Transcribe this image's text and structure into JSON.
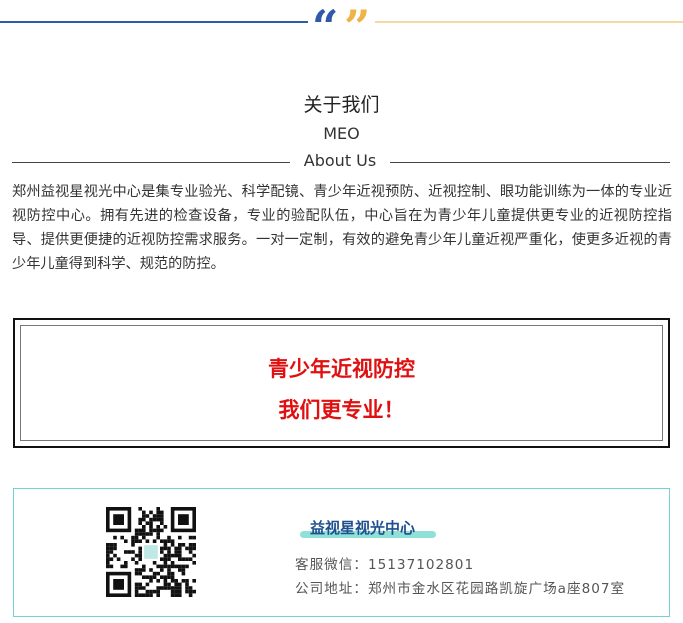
{
  "header": {
    "quote_open": "“",
    "quote_close": "”",
    "colors": {
      "left_rule": "#2e5aa8",
      "right_rule": "#f3d9a4",
      "open_quote": "#2e5aa8",
      "close_quote": "#f0b34a"
    }
  },
  "about": {
    "title_zh": "关于我们",
    "title_abbr": "MEO",
    "title_en": "About Us",
    "intro": "郑州益视星视光中心是集专业验光、科学配镜、青少年近视预防、近视控制、眼功能训练为一体的专业近视防控中心。拥有先进的检查设备，专业的验配队伍，中心旨在为青少年儿童提供更专业的近视防控指导、提供更便捷的近视防控需求服务。一对一定制，有效的避免青少年儿童近视严重化，使更多近视的青少年儿童得到科学、规范的防控。"
  },
  "slogan": {
    "line1": "青少年近视防控",
    "line2": "我们更专业！",
    "color": "#e01010"
  },
  "contact": {
    "brand": "益视星视光中心",
    "wechat": "客服微信：15137102801",
    "address": "公司地址：郑州市金水区花园路凯旋广场a座807室",
    "qr_icon": "qr-code",
    "accent": "#6fd3d8"
  }
}
